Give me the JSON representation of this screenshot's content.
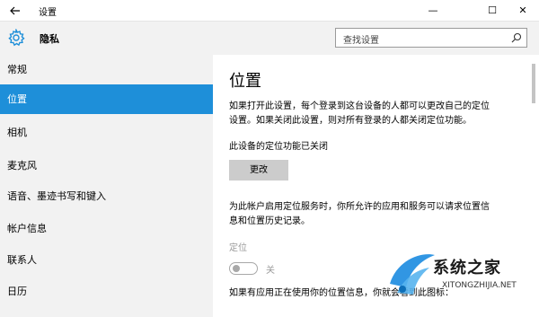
{
  "window": {
    "title": "设置",
    "back_icon": "arrow-left-icon",
    "minimize_glyph": "—",
    "maximize_glyph": "☐",
    "close_glyph": "✕"
  },
  "header": {
    "title": "隐私",
    "icon": "gear-icon",
    "search_placeholder": "查找设置"
  },
  "sidebar": {
    "items": [
      {
        "label": "常规"
      },
      {
        "label": "位置",
        "selected": true
      },
      {
        "label": "相机"
      },
      {
        "label": "麦克风"
      },
      {
        "label": "语音、墨迹书写和键入"
      },
      {
        "label": "帐户信息"
      },
      {
        "label": "联系人"
      },
      {
        "label": "日历"
      }
    ]
  },
  "main": {
    "heading": "位置",
    "para1_line1": "如果打开此设置，每个登录到这台设备的人都可以更改自己的定位",
    "para1_line2": "设置。如果关闭此设置，则对所有登录的人都关闭定位功能。",
    "status": "此设备的定位功能已关闭",
    "change_button": "更改",
    "para2_line1": "为此帐户启用定位服务时，你所允许的应用和服务可以请求位置信",
    "para2_line2": "息和位置历史记录。",
    "toggle_label": "定位",
    "toggle_state": "关",
    "toggle_on": false,
    "para3": "如果有应用正在使用你的位置信息，你就会看到此图标："
  },
  "watermark": {
    "text": "系统之家",
    "url": "XITONGZHIJIA.NET"
  },
  "colors": {
    "accent": "#1e8fd9",
    "sidebar_bg": "#f2f2f2",
    "button_bg": "#cccccc",
    "disabled_text": "#9a9a9a"
  }
}
